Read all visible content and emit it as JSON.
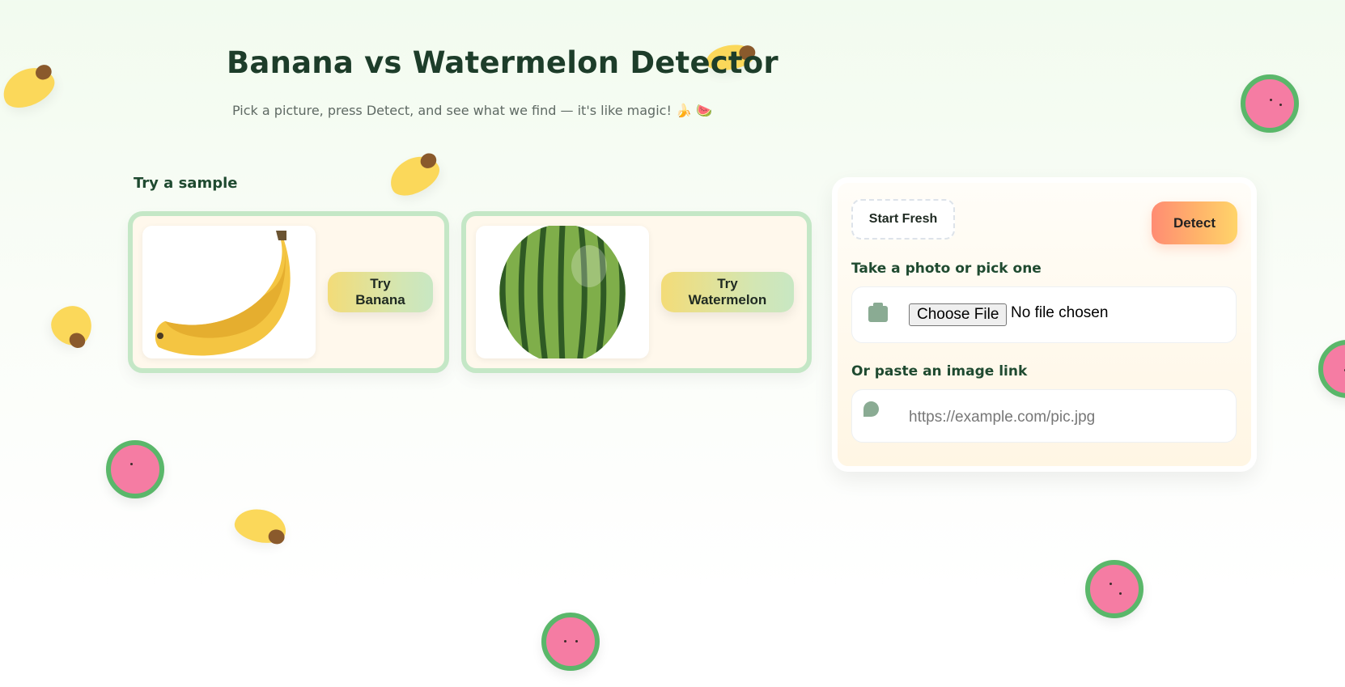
{
  "header": {
    "title": "Banana vs Watermelon Detector",
    "subtitle": "Pick a picture, press Detect, and see what we find — it's like magic! 🍌 🍉"
  },
  "samples": {
    "heading": "Try a sample",
    "items": [
      {
        "label": "Try Banana",
        "image": "banana-photo"
      },
      {
        "label": "Try Watermelon",
        "image": "watermelon-photo"
      }
    ]
  },
  "panel": {
    "start_label": "Start Fresh",
    "detect_label": "Detect",
    "photo_label": "Take a photo or pick one",
    "choose_file_label": "Choose File",
    "file_status": "No file chosen",
    "link_label": "Or paste an image link",
    "url_value": "",
    "url_placeholder": "https://example.com/pic.jpg"
  },
  "colors": {
    "title": "#1d3d2a",
    "card_border": "#c4e7c6",
    "detect_gradient_start": "#ff8c73",
    "detect_gradient_end": "#ffd46a",
    "banana": "#fbd85a",
    "melon_flesh": "#f57ca3",
    "melon_rind": "#5ab76a"
  }
}
